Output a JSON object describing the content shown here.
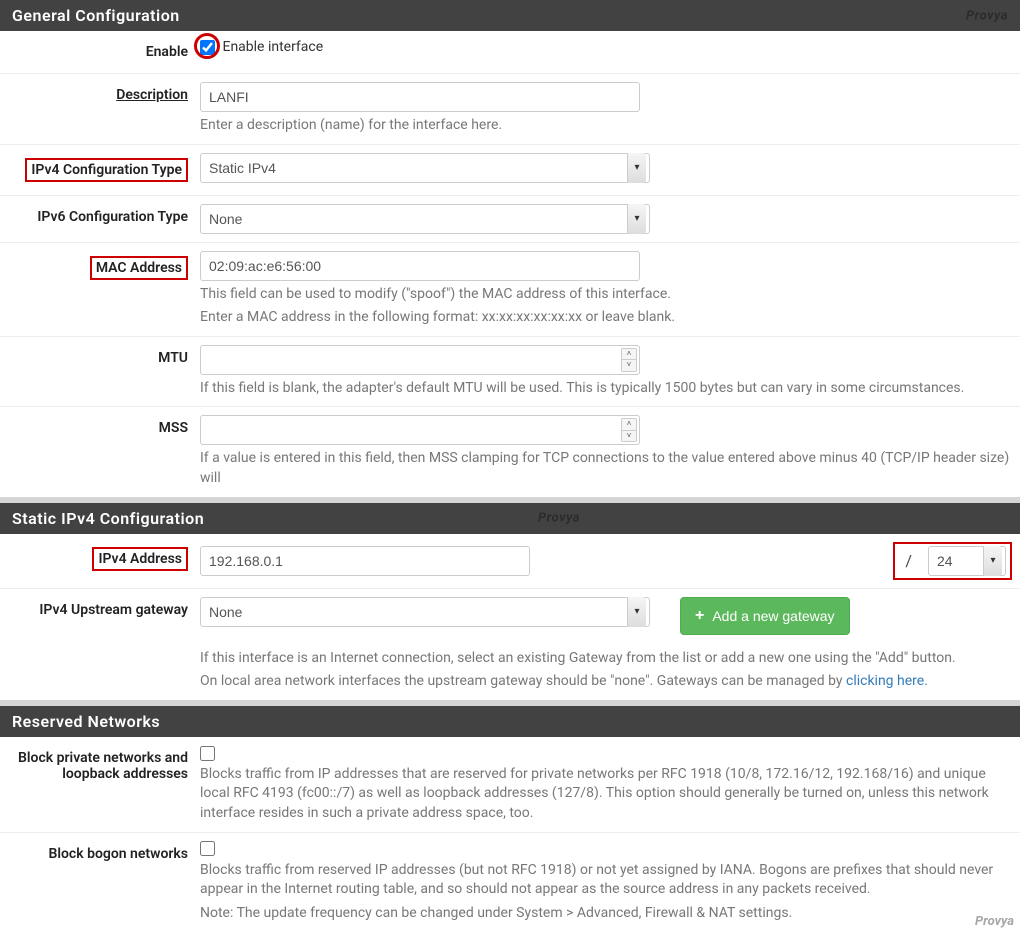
{
  "watermark": "Provya",
  "sections": {
    "general": {
      "title": "General Configuration"
    },
    "static": {
      "title": "Static IPv4 Configuration"
    },
    "reserved": {
      "title": "Reserved Networks"
    }
  },
  "enable": {
    "label": "Enable",
    "checkbox_label": "Enable interface",
    "checked": true
  },
  "description": {
    "label": "Description",
    "value": "LANFI",
    "help": "Enter a description (name) for the interface here."
  },
  "ipv4type": {
    "label": "IPv4 Configuration Type",
    "value": "Static IPv4"
  },
  "ipv6type": {
    "label": "IPv6 Configuration Type",
    "value": "None"
  },
  "mac": {
    "label": "MAC Address",
    "value": "02:09:ac:e6:56:00",
    "help1": "This field can be used to modify (\"spoof\") the MAC address of this interface.",
    "help2": "Enter a MAC address in the following format: xx:xx:xx:xx:xx:xx or leave blank."
  },
  "mtu": {
    "label": "MTU",
    "value": "",
    "help": "If this field is blank, the adapter's default MTU will be used. This is typically 1500 bytes but can vary in some circumstances."
  },
  "mss": {
    "label": "MSS",
    "value": "",
    "help": "If a value is entered in this field, then MSS clamping for TCP connections to the value entered above minus 40 (TCP/IP header size) will"
  },
  "ipv4addr": {
    "label": "IPv4 Address",
    "value": "192.168.0.1",
    "slash": "/",
    "prefix": "24"
  },
  "gateway": {
    "label": "IPv4 Upstream gateway",
    "value": "None",
    "button": "Add a new gateway",
    "help1": "If this interface is an Internet connection, select an existing Gateway from the list or add a new one using the \"Add\" button.",
    "help2a": "On local area network interfaces the upstream gateway should be \"none\". Gateways can be managed by ",
    "help2b": "clicking here."
  },
  "blockprivate": {
    "label": "Block private networks and loopback addresses",
    "checked": false,
    "help": "Blocks traffic from IP addresses that are reserved for private networks per RFC 1918 (10/8, 172.16/12, 192.168/16) and unique local RFC 4193 (fc00::/7) as well as loopback addresses (127/8). This option should generally be turned on, unless this network interface resides in such a private address space, too."
  },
  "blockbogon": {
    "label": "Block bogon networks",
    "checked": false,
    "help1": "Blocks traffic from reserved IP addresses (but not RFC 1918) or not yet assigned by IANA. Bogons are prefixes that should never appear in the Internet routing table, and so should not appear as the source address in any packets received.",
    "help2": "Note: The update frequency can be changed under System > Advanced, Firewall & NAT settings."
  }
}
